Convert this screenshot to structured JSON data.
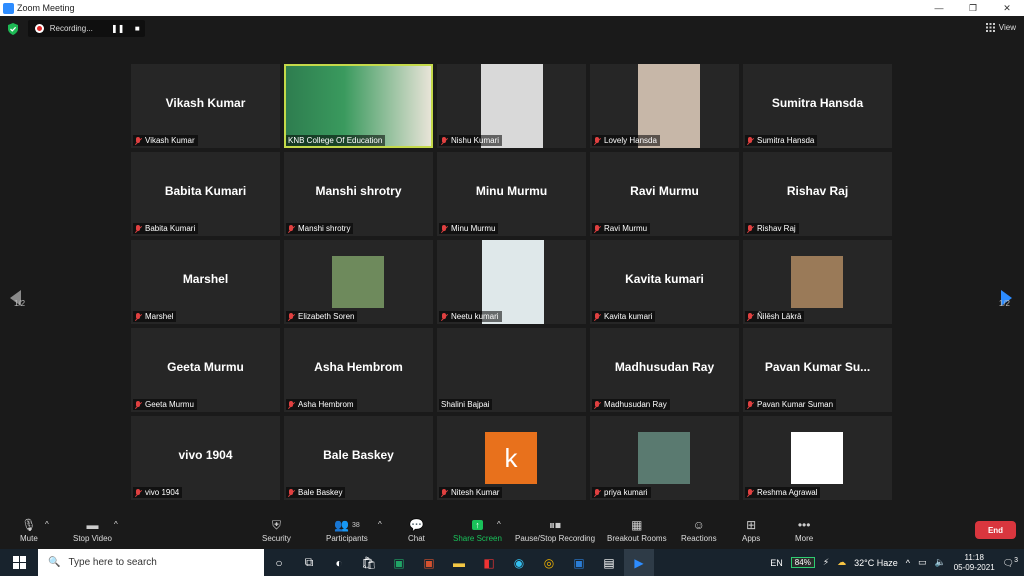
{
  "window": {
    "title": "Zoom Meeting",
    "minimize": "—",
    "restore": "❐",
    "close": "✕"
  },
  "recording": {
    "status": "Recording...",
    "pause": "❚❚",
    "stop": "■"
  },
  "view": {
    "label": "View"
  },
  "pager": {
    "left": "1/2",
    "right": "1/2"
  },
  "tiles": [
    {
      "name": "Vikash Kumar",
      "label": "Vikash Kumar"
    },
    {
      "name": "",
      "label": "KNB College Of Education"
    },
    {
      "name": "",
      "label": "Nishu Kumari"
    },
    {
      "name": "",
      "label": "Lovely Hansda"
    },
    {
      "name": "Sumitra Hansda",
      "label": "Sumitra Hansda"
    },
    {
      "name": "Babita Kumari",
      "label": "Babita Kumari"
    },
    {
      "name": "Manshi shrotry",
      "label": "Manshi shrotry"
    },
    {
      "name": "Minu Murmu",
      "label": "Minu Murmu"
    },
    {
      "name": "Ravi Murmu",
      "label": "Ravi Murmu"
    },
    {
      "name": "Rishav Raj",
      "label": "Rishav Raj"
    },
    {
      "name": "Marshel",
      "label": "Marshel"
    },
    {
      "name": "",
      "label": "Elizabeth Soren"
    },
    {
      "name": "",
      "label": "Neetu kumari"
    },
    {
      "name": "Kavita kumari",
      "label": "Kavita kumari"
    },
    {
      "name": "",
      "label": "Ñilēsh Lākrā"
    },
    {
      "name": "Geeta Murmu",
      "label": "Geeta Murmu"
    },
    {
      "name": "Asha Hembrom",
      "label": "Asha Hembrom"
    },
    {
      "name": "",
      "label": "Shalini Bajpai"
    },
    {
      "name": "Madhusudan Ray",
      "label": "Madhusudan Ray"
    },
    {
      "name": "Pavan Kumar Su...",
      "label": "Pavan Kumar Suman"
    },
    {
      "name": "vivo 1904",
      "label": "vivo 1904"
    },
    {
      "name": "Bale Baskey",
      "label": "Bale Baskey"
    },
    {
      "name": "",
      "label": "Nitesh Kumar",
      "avatar_letter": "k"
    },
    {
      "name": "",
      "label": "priya kumari"
    },
    {
      "name": "",
      "label": "Reshma Agrawal"
    }
  ],
  "toolbar": {
    "mute": "Mute",
    "stop_video": "Stop Video",
    "security": "Security",
    "participants": "Participants",
    "participants_count": "38",
    "chat": "Chat",
    "share_screen": "Share Screen",
    "pause_stop_recording": "Pause/Stop Recording",
    "breakout_rooms": "Breakout Rooms",
    "reactions": "Reactions",
    "apps": "Apps",
    "more": "More",
    "end": "End"
  },
  "taskbar": {
    "search_placeholder": "Type here to search",
    "language": "EN",
    "battery": "84%",
    "weather": "32°C  Haze",
    "time": "11:18",
    "date": "05-09-2021",
    "notifications": "3"
  },
  "colors": {
    "accent": "#2d8cff",
    "active_speaker": "#c4d94a",
    "end": "#d9363e",
    "share": "#19c15a",
    "nitesh_avatar": "#e8711c"
  }
}
